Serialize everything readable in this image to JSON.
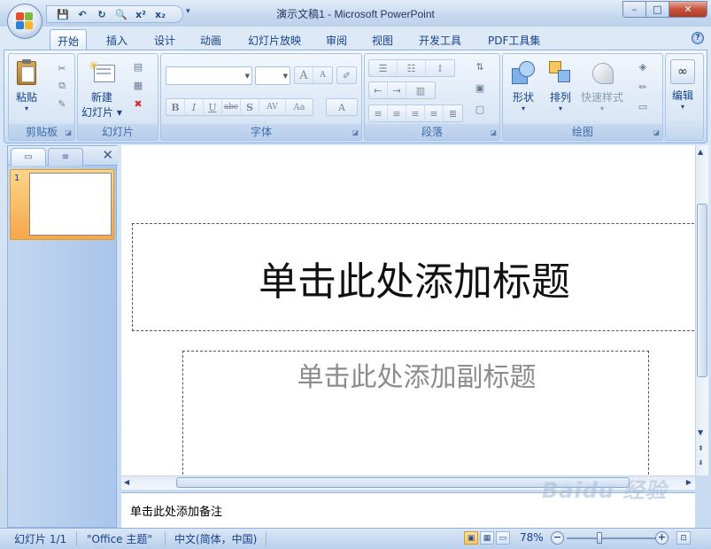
{
  "window": {
    "title": "演示文稿1 - Microsoft PowerPoint",
    "minimize": "–",
    "maximize": "□",
    "close": "✕"
  },
  "qat": {
    "save": "💾",
    "undo": "↶",
    "redo": "↻",
    "print_preview": "🔍",
    "superscript": "x²",
    "subscript": "x₂",
    "more": "▾"
  },
  "tabs": [
    "开始",
    "插入",
    "设计",
    "动画",
    "幻灯片放映",
    "审阅",
    "视图",
    "开发工具",
    "PDF工具集"
  ],
  "active_tab": "开始",
  "help": "?",
  "ribbon": {
    "clipboard": {
      "label": "剪贴板",
      "paste": "粘贴",
      "paste_arrow": "▾"
    },
    "slides": {
      "label": "幻灯片",
      "new_slide_1": "新建",
      "new_slide_2": "幻灯片 ▾"
    },
    "font": {
      "label": "字体",
      "format_buttons": [
        "B",
        "I",
        "U",
        "abc",
        "S",
        "AV",
        "Aa"
      ],
      "grow": "A",
      "shrink": "A",
      "color": "A"
    },
    "paragraph": {
      "label": "段落"
    },
    "drawing": {
      "label": "绘图",
      "shapes": "形状",
      "arrange": "排列",
      "quick_styles": "快速样式",
      "arrow": "▾"
    },
    "editing": {
      "label": "编辑",
      "arrow": "▾"
    }
  },
  "thumbnail_pane": {
    "close": "✕",
    "slide_number": "1"
  },
  "slide": {
    "title_placeholder": "单击此处添加标题",
    "subtitle_placeholder": "单击此处添加副标题"
  },
  "notes": {
    "placeholder": "单击此处添加备注"
  },
  "status": {
    "slide": "幻灯片 1/1",
    "theme": "\"Office 主题\"",
    "language": "中文(简体，中国)",
    "zoom": "78%",
    "zoom_level_percent": 78
  },
  "watermark": "Baidu 经验",
  "colors": {
    "accent": "#15428b",
    "ribbon_bg": "#dbe8f6",
    "selected_thumb": "#f5a74a"
  }
}
